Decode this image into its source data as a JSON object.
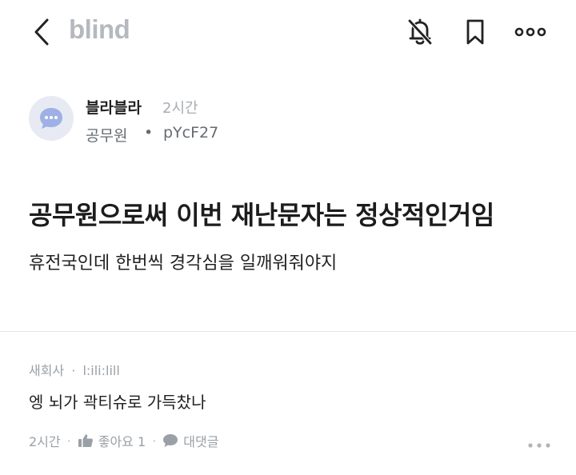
{
  "header": {
    "logo": "blind",
    "icons": [
      "chevron-left-icon",
      "bell-off-icon",
      "bookmark-icon",
      "more-horizontal-icon"
    ]
  },
  "author": {
    "name": "블라블라",
    "time": "2시간",
    "company": "공무원",
    "separator": "•",
    "user_id": "pYcF27"
  },
  "post": {
    "title": "공무원으로써 이번 재난문자는 정상적인거임",
    "body": "휴전국인데 한번씩 경각심을 일깨워줘야지"
  },
  "comment": {
    "company": "새회사",
    "meta_sep": "·",
    "user_id": "l:ili:lill",
    "body": "엥 뇌가 곽티슈로 가득찼나",
    "time": "2시간",
    "like_label": "좋아요 1",
    "reply_label": "대댓글",
    "action_sep": "·"
  },
  "colors": {
    "logo": "#b5b9bf",
    "muted": "#9aa0a6",
    "avatar_bg": "#e7eaf2",
    "avatar_bubble": "#9fb0e6"
  }
}
